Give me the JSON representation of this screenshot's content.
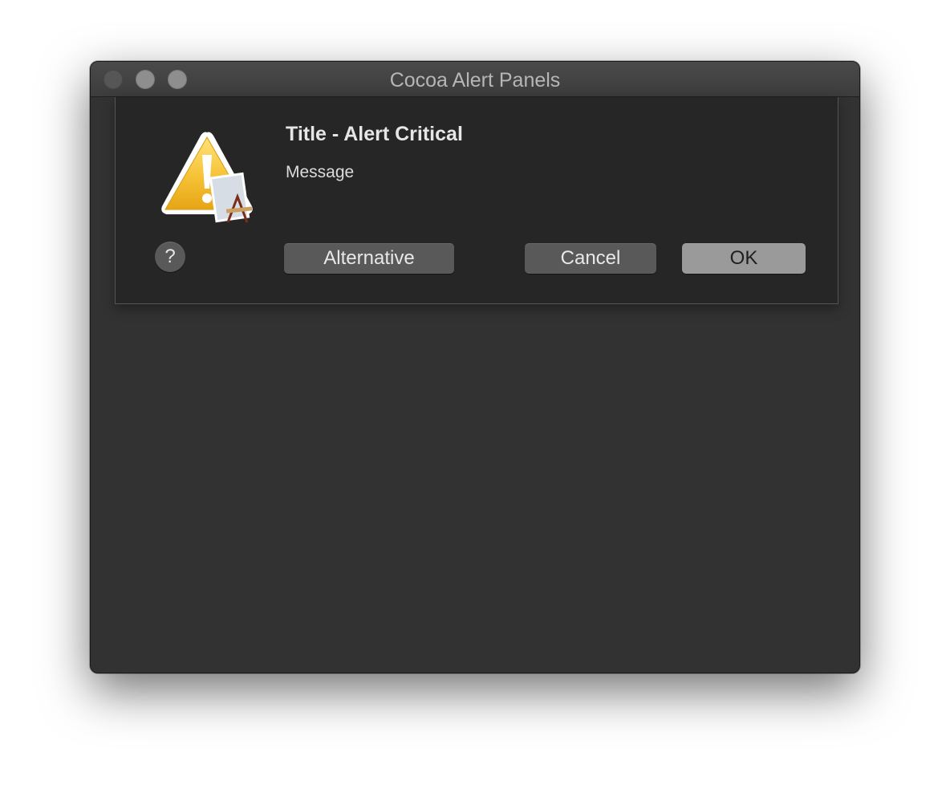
{
  "window": {
    "title": "Cocoa Alert Panels"
  },
  "alert": {
    "icon": "caution-triangle-with-app-icon",
    "title": "Title - Alert Critical",
    "message": "Message",
    "help_symbol": "?",
    "buttons": {
      "alternative": "Alternative",
      "cancel": "Cancel",
      "ok": "OK"
    }
  },
  "colors": {
    "window_bg": "#323232",
    "sheet_bg": "#262626",
    "default_button": "#9a9a9a",
    "warning_yellow": "#f2b922"
  }
}
